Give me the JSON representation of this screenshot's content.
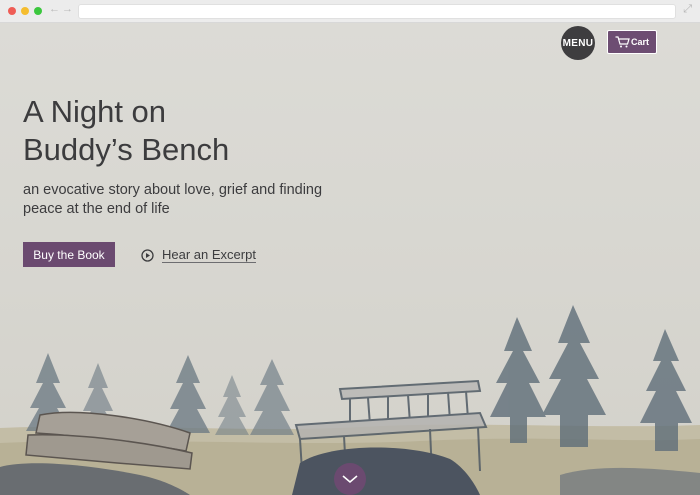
{
  "browser": {
    "dots": [
      "close",
      "minimize",
      "maximize"
    ],
    "nav_icons": [
      "back-arrow-icon",
      "forward-arrow-icon"
    ],
    "back_glyph": "←",
    "forward_glyph": "→",
    "expand_glyph": "⤢"
  },
  "header": {
    "menu_label": "MENU",
    "cart_label": "Cart",
    "cart_icon": "cart-icon",
    "accent": "#6b4a70"
  },
  "hero": {
    "title_line1": "A Night on",
    "title_line2": "Buddy’s Bench",
    "subtitle": "an evocative story about love, grief and finding peace at the end of life",
    "primary_button": "Buy the Book",
    "secondary_link": "Hear an Excerpt",
    "secondary_icon": "play-circle-icon",
    "scroll_icon": "chevron-down-icon"
  },
  "colors": {
    "primary": "#6b4a70",
    "text": "#3c3c3e",
    "menu_bg": "#3e3d3f",
    "paper": "#d9d8d2"
  }
}
